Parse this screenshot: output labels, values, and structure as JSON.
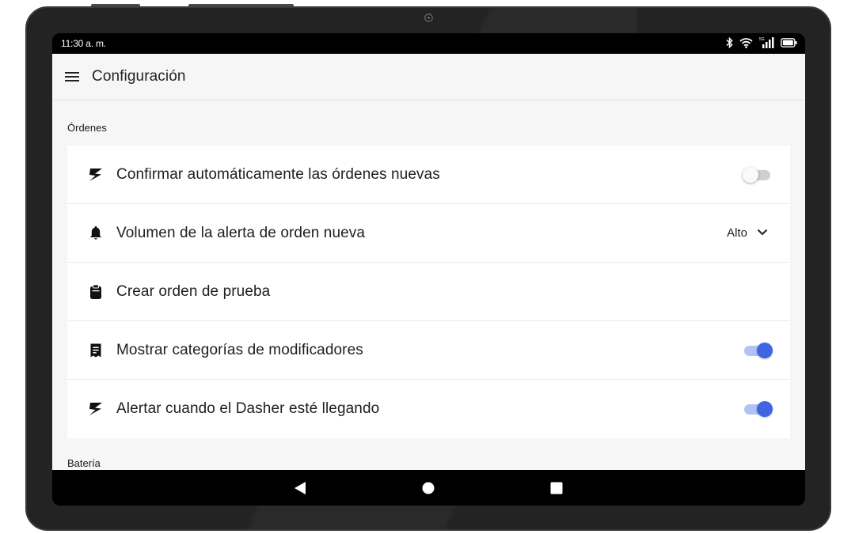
{
  "status_bar": {
    "time": "11:30 a. m.",
    "icons": [
      "bluetooth-icon",
      "wifi-icon",
      "signal-icon",
      "battery-icon"
    ],
    "signal_label": "5G"
  },
  "app_bar": {
    "title": "Configuración",
    "menu_icon": "hamburger-menu-icon"
  },
  "sections": {
    "orders": {
      "title": "Órdenes",
      "items": [
        {
          "label": "Confirmar automáticamente las órdenes nuevas",
          "icon": "lightning-icon",
          "control": "toggle",
          "enabled": false
        },
        {
          "label": "Volumen de la alerta de orden nueva",
          "icon": "bell-icon",
          "control": "select",
          "value": "Alto"
        },
        {
          "label": "Crear orden de prueba",
          "icon": "clipboard-icon",
          "control": "none"
        },
        {
          "label": "Mostrar categorías de modificadores",
          "icon": "receipt-icon",
          "control": "toggle",
          "enabled": true
        },
        {
          "label": "Alertar cuando el Dasher esté llegando",
          "icon": "lightning-icon",
          "control": "toggle",
          "enabled": true
        }
      ]
    },
    "battery": {
      "title": "Batería"
    }
  },
  "nav_bar": {
    "buttons": [
      "back-icon",
      "home-icon",
      "recents-icon"
    ]
  },
  "colors": {
    "accent": "#3f65e3",
    "accent_track": "#b3c2f4",
    "background": "#f6f6f6",
    "device_frame": "#232323"
  }
}
